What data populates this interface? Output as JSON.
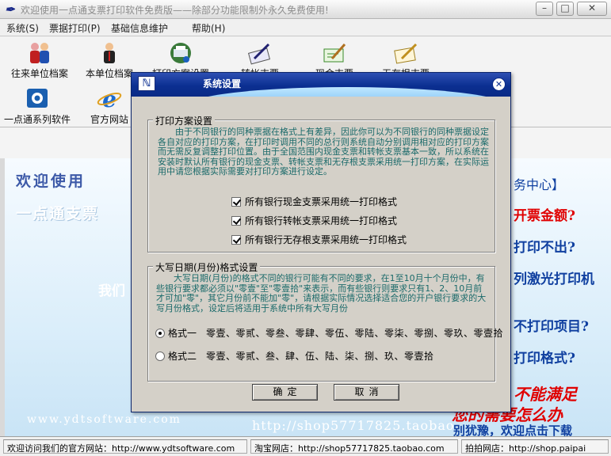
{
  "window": {
    "title": "欢迎使用一点通支票打印软件免费版——除部分功能限制外永久免费使用!",
    "controls": {
      "minimize": "–",
      "maximize": "□",
      "close": "✕"
    }
  },
  "menu": [
    "系统(S)",
    "票据打印(P)",
    "基础信息维护",
    "帮助(H)"
  ],
  "toolbar": {
    "row1": [
      {
        "label": "往来单位档案",
        "icon": "people-icon"
      },
      {
        "label": "本单位档案",
        "icon": "person-icon"
      },
      {
        "label": "打印方案设置",
        "icon": "printer-settings-icon"
      },
      {
        "label": "转帐支票",
        "icon": "pen-check-icon"
      },
      {
        "label": "现金支票",
        "icon": "cash-check-icon"
      },
      {
        "label": "无存根支票",
        "icon": "stubless-check-icon"
      }
    ],
    "row2": [
      {
        "label": "一点通系列软件",
        "icon": "software-icon"
      },
      {
        "label": "官方网站",
        "icon": "ie-icon"
      }
    ]
  },
  "background": {
    "welcome_line1": "欢迎使用",
    "welcome_line2": "一点通支票",
    "welcome_line3": "我们",
    "site_watermark": "www.ydtsoftware.com",
    "shop_watermark": "http://shop57717825.taobao",
    "right_texts": [
      "务中心】",
      "开票金额?",
      "打印不出?",
      "列激光打印机",
      "不打印项目?",
      "打印格式?",
      "不能满足",
      "您的需要怎么办",
      "别犹豫，欢迎点击下载"
    ]
  },
  "dialog": {
    "title": "系统设置",
    "close": "✕",
    "print_group": {
      "title": "打印方案设置",
      "description": "由于不同银行的同种票据在格式上有差异，因此你可以为不同银行的同种票据设定各自对应的打印方案，在打印时调用不同的总行则系统自动分别调用相对应的打印方案而无需反复调整打印位置。由于全国范围内现金支票和转帐支票基本一致，所以系统在安装时默认所有银行的现金支票、转帐支票和无存根支票采用统一打印方案，在实际运用中请您根据实际需要对打印方案进行设定。",
      "options": [
        {
          "label": "所有银行现金支票采用统一打印格式",
          "checked": true
        },
        {
          "label": "所有银行转帐支票采用统一打印格式",
          "checked": true
        },
        {
          "label": "所有银行无存根支票采用统一打印格式",
          "checked": true
        }
      ]
    },
    "date_group": {
      "title": "大写日期(月份)格式设置",
      "description": "大写日期(月份)的格式不同的银行可能有不同的要求，在1至10月十个月份中，有些银行要求都必须以\"零壹\"至\"零壹拾\"来表示，而有些银行则要求只有1、2、10月前才可加\"零\"，其它月份前不能加\"零\"，请根据实际情况选择适合您的开户银行要求的大写月份格式，设定后将适用于系统中所有大写月份",
      "options": [
        {
          "label": "格式一",
          "sample": "零壹、零贰、零叁、零肆、零伍、零陆、零柒、零捌、零玖、零壹拾",
          "selected": true
        },
        {
          "label": "格式二",
          "sample": "零壹、零贰、叁、肆、伍、陆、柒、捌、玖、零壹拾",
          "selected": false
        }
      ]
    },
    "buttons": {
      "ok": "确定",
      "cancel": "取消"
    }
  },
  "status": [
    "欢迎访问我们的官方网站：http://www.ydtsoftware.com",
    "淘宝网店：http://shop57717825.taobao.com",
    "拍拍网店：http://shop.paipai"
  ]
}
